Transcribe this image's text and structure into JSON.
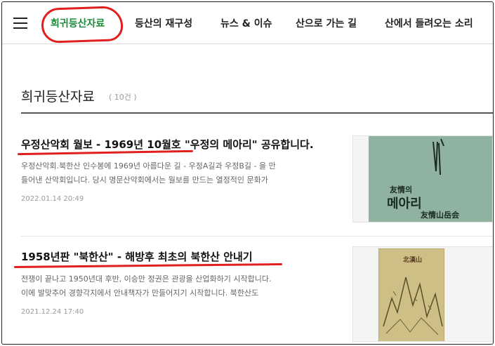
{
  "nav": {
    "menu_icon": "hamburger-menu-icon",
    "items": [
      {
        "label": "희귀등산자료",
        "active": true
      },
      {
        "label": "등산의 재구성",
        "active": false
      },
      {
        "label": "뉴스 & 이슈",
        "active": false
      },
      {
        "label": "산으로 가는 길",
        "active": false
      },
      {
        "label": "산에서 들려오는 소리",
        "active": false
      }
    ]
  },
  "section": {
    "title": "희귀등산자료",
    "count": "( 10건 )"
  },
  "articles": [
    {
      "title": "우정산악회 월보 - 1969년 10월호 \"우정의 메아리\" 공유합니다.",
      "excerpt_line1": "우정산악회.북한산 인수봉에 1969년 아름다운 길 - 우정A길과 우정B길 - 을 만",
      "excerpt_line2": "들어낸 산악회입니다. 당시 명문산악회에서는 월보를 만드는 열정적인 문화가",
      "date": "2022.01.14 20:49",
      "thumb_text_1": "友情의",
      "thumb_text_2": "메아리",
      "thumb_text_3": "友情山岳会"
    },
    {
      "title": "1958년판 \"북한산\" - 해방후 최초의 북한산 안내기",
      "excerpt_line1": "전쟁이 끝나고 1950년대 후반, 이승만 정권은 관광을 산업화하기 시작합니다.",
      "excerpt_line2": "이에 발맞추어 경향각지에서 안내책자가 만들어지기 시작합니다. 북한산도",
      "date": "2021.12.24 17:40",
      "thumb_text_1": "北漢山"
    }
  ],
  "colors": {
    "accent_green": "#1e8c3a",
    "annotation_red": "#e0201f"
  }
}
